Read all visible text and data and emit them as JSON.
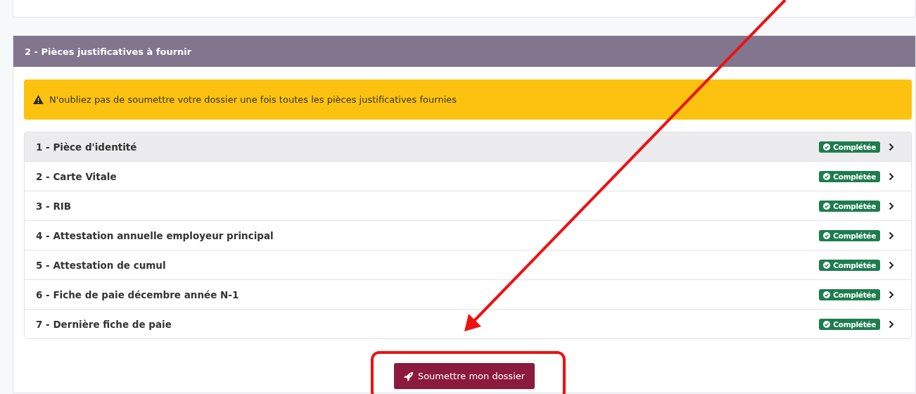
{
  "section": {
    "title": "2 - Pièces justificatives à fournir"
  },
  "alert": {
    "text": "N'oubliez pas de soumettre votre dossier une fois toutes les pièces justificatives fournies"
  },
  "documents": [
    {
      "label": "1 - Pièce d'identité",
      "status": "Complétée",
      "hovered": true
    },
    {
      "label": "2 - Carte Vitale",
      "status": "Complétée",
      "hovered": false
    },
    {
      "label": "3 - RIB",
      "status": "Complétée",
      "hovered": false
    },
    {
      "label": "4 - Attestation annuelle employeur principal",
      "status": "Complétée",
      "hovered": false
    },
    {
      "label": "5 - Attestation de cumul",
      "status": "Complétée",
      "hovered": false
    },
    {
      "label": "6 - Fiche de paie décembre année N-1",
      "status": "Complétée",
      "hovered": false
    },
    {
      "label": "7 - Dernière fiche de paie",
      "status": "Complétée",
      "hovered": false
    }
  ],
  "submit_button": {
    "label": "Soumettre mon dossier"
  },
  "annotations": {
    "arrow_shown": true,
    "highlight_shown": true
  }
}
